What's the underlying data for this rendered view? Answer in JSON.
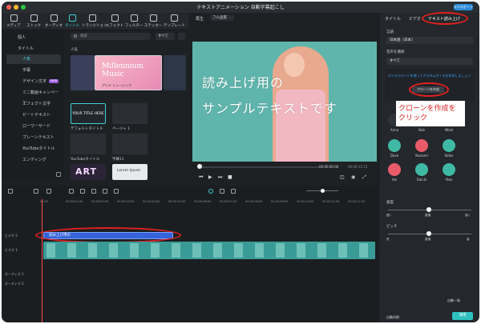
{
  "window": {
    "title": "テキストアニメーション  自動字幕起こし",
    "top_button": "エクスポート"
  },
  "toolbar": {
    "items": [
      "メディア",
      "ストック",
      "オーディオ",
      "タイトル",
      "トランジション",
      "エフェクト",
      "フィルター",
      "ステッカー",
      "テンプレート"
    ]
  },
  "sidebar": {
    "items": [
      {
        "label": "個人"
      },
      {
        "label": "タイトル"
      },
      {
        "label": "人気"
      },
      {
        "label": "字幕"
      },
      {
        "label": "デザイン文字",
        "badge": "NEW"
      },
      {
        "label": "ミニ動画キャンペーン"
      },
      {
        "label": "エフェクト文字"
      },
      {
        "label": "ビートテキスト"
      },
      {
        "label": "ローワーサード"
      },
      {
        "label": "プレーンテキスト"
      },
      {
        "label": "YouTubeタイトル"
      },
      {
        "label": "エンディング"
      }
    ]
  },
  "browser": {
    "search_placeholder": "検索",
    "filter": "すべて",
    "section": "人気",
    "thumbs": [
      {
        "label": "",
        "overlay": "Millennium Music"
      },
      {
        "label": "デフォルトタイトル",
        "overlay": "YOUR TITLE HERE"
      },
      {
        "label": "ページャ 1",
        "overlay": ""
      },
      {
        "label": "YouTubeタイトル",
        "overlay": ""
      },
      {
        "label": "字幕11",
        "overlay": ""
      },
      {
        "label": "",
        "overlay": "ART"
      },
      {
        "label": "",
        "overlay": "Lorem Ipsum"
      }
    ],
    "featured_caption": "アニメ ミュージック"
  },
  "preview": {
    "tab": "再生",
    "quality": "フル品質",
    "text_line1": "読み上げ用の",
    "text_line2": "サンプルテキストです",
    "time_current": "00:00:00:00",
    "time_total": "00:00:12:15"
  },
  "props": {
    "tabs": [
      "タイトル",
      "ビデオ",
      "テキスト読み上げ"
    ],
    "language_label": "言語",
    "language_value": "日本語（日本）",
    "voice_label": "音声を選択",
    "voice_value": "すべて",
    "clone_hint": "ボイスクローンを使ってカスタムボイスを作成しましょう",
    "clone_button": "クローンを作成",
    "annotation": "クローンを作成をクリック",
    "voices_row1": [
      "Anna",
      "Bob",
      "Mikel"
    ],
    "voices_row2": [
      "Dave",
      "Nanami",
      "Keita"
    ],
    "voices_row3": [
      "Aoi",
      "Daichi",
      "Alex"
    ],
    "speed_label": "速度",
    "speed_marks": [
      "遅く",
      "普通",
      "速く"
    ],
    "pitch_label": "ピッチ",
    "pitch_marks": [
      "低",
      "普通",
      "高"
    ],
    "auto_match": "自動一致",
    "apply": "適用",
    "auto_sync": "自動同期"
  },
  "timeline": {
    "ticks": [
      "00:00",
      "00:00:01:00",
      "00:00:02:00",
      "00:00:03:00",
      "00:00:04:00",
      "00:00:05:00",
      "00:00:06:00",
      "00:00:07:00",
      "00:00:08:00",
      "00:00:09:00",
      "00:00:10:00",
      "00:00:11:00",
      "00:00:12:00"
    ],
    "text_clip": "読み上げ用の",
    "tracks": [
      "ビデオ 2",
      "ビデオ 1",
      "オーディオ 1",
      "オーディオ 2"
    ]
  },
  "colors": {
    "accent": "#3fd0d6",
    "annotation": "#e02121",
    "text_clip": "#3564d8",
    "video_clip": "#3a9b96"
  }
}
